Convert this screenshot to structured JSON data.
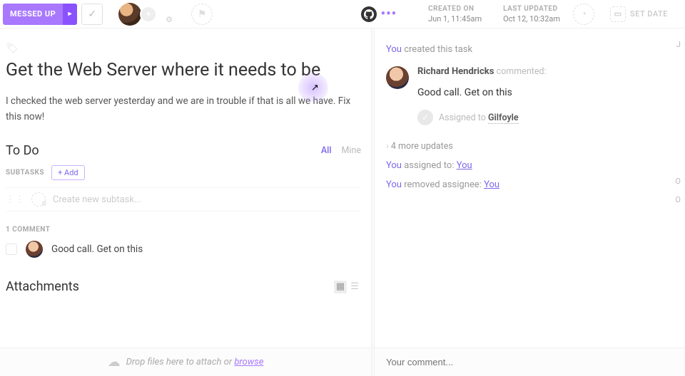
{
  "colors": {
    "accent": "#a878ff",
    "link": "#7b68ee"
  },
  "toolbar": {
    "status_label": "MESSED UP",
    "caret": "▸",
    "check": "✓",
    "flag": "⚑"
  },
  "meta": {
    "created_label": "CREATED ON",
    "created_value": "Jun 1, 11:45am",
    "updated_label": "LAST UPDATED",
    "updated_value": "Oct 12, 10:32am",
    "setdate_label": "SET DATE"
  },
  "task": {
    "title": "Get the Web Server where it needs to be",
    "description": "I checked the web server yesterday and we are in trouble if that is all we have. Fix this now!"
  },
  "todo": {
    "heading": "To Do",
    "filter_all": "All",
    "filter_mine": "Mine",
    "subtasks_label": "SUBTASKS",
    "add_label": "+ Add",
    "new_placeholder": "Create new subtask..."
  },
  "comments": {
    "count_label": "1 COMMENT",
    "items": [
      {
        "text": "Good call. Get on this"
      }
    ]
  },
  "attachments": {
    "heading": "Attachments"
  },
  "activity": {
    "you": "You",
    "created": " created this task",
    "commenter": "Richard Hendricks",
    "commented_label": " commented:",
    "comment_text": "Good call. Get on this",
    "assigned_to_label": "Assigned to ",
    "assigned_to_name": "Gilfoyle",
    "more_updates": "4 more updates",
    "line_assigned": " assigned to: ",
    "line_removed": " removed assignee: ",
    "target_you": "You",
    "marker1": "J",
    "marker2": "O",
    "marker3": "O"
  },
  "footer": {
    "drop_text": "Drop files here to attach or ",
    "browse": "browse",
    "comment_placeholder": "Your comment..."
  }
}
